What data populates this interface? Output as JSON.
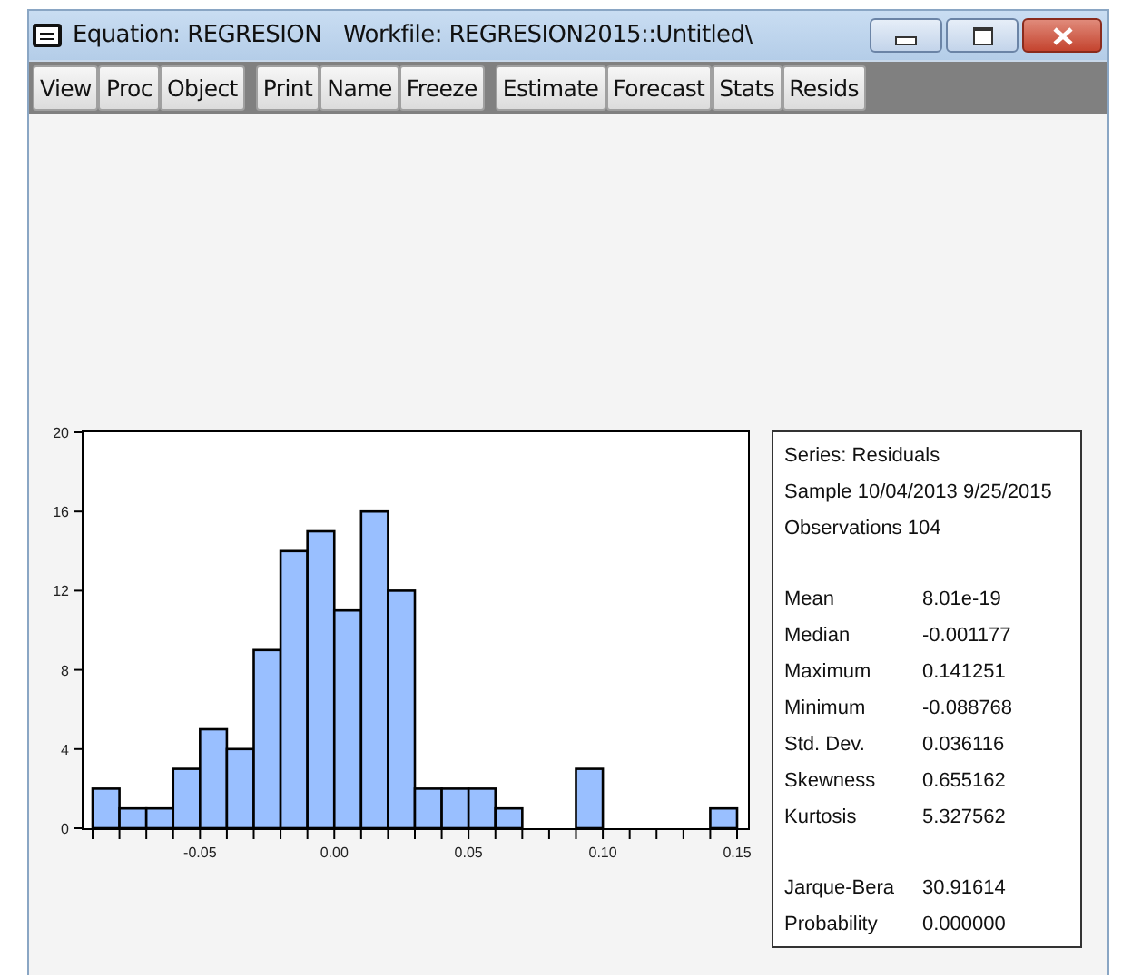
{
  "window": {
    "title": "Equation: REGRESION",
    "workfile": "Workfile: REGRESION2015::Untitled\\"
  },
  "toolbar": [
    [
      "View",
      "Proc",
      "Object"
    ],
    [
      "Print",
      "Name",
      "Freeze"
    ],
    [
      "Estimate",
      "Forecast",
      "Stats",
      "Resids"
    ]
  ],
  "histogram": {
    "chart_data": {
      "type": "bar",
      "x": [
        -0.085,
        -0.075,
        -0.065,
        -0.055,
        -0.045,
        -0.035,
        -0.025,
        -0.015,
        -0.005,
        0.005,
        0.015,
        0.025,
        0.035,
        0.045,
        0.055,
        0.065,
        0.075,
        0.085,
        0.095,
        0.105,
        0.115,
        0.125,
        0.135,
        0.145
      ],
      "values": [
        2,
        1,
        1,
        3,
        5,
        4,
        9,
        14,
        15,
        11,
        16,
        12,
        2,
        2,
        2,
        1,
        0,
        0,
        3,
        0,
        0,
        0,
        0,
        1
      ],
      "xlim": [
        -0.09,
        0.15
      ],
      "ylim": [
        0,
        20
      ],
      "xticks": [
        {
          "value": -0.05,
          "label": "-0.05"
        },
        {
          "value": 0,
          "label": "0.00"
        },
        {
          "value": 0.05,
          "label": "0.05"
        },
        {
          "value": 0.1,
          "label": "0.10"
        },
        {
          "value": 0.15,
          "label": "0.15"
        }
      ],
      "yticks": [
        0,
        4,
        8,
        12,
        16,
        20
      ]
    }
  },
  "stats": {
    "header": [
      "Series: Residuals",
      "Sample 10/04/2013 9/25/2015",
      "Observations 104"
    ],
    "groups": [
      [
        {
          "label": "Mean",
          "value": "8.01e-19"
        },
        {
          "label": "Median",
          "value": "-0.001177"
        },
        {
          "label": "Maximum",
          "value": "0.141251"
        },
        {
          "label": "Minimum",
          "value": "-0.088768"
        },
        {
          "label": "Std. Dev.",
          "value": "0.036116"
        },
        {
          "label": "Skewness",
          "value": "0.655162"
        },
        {
          "label": "Kurtosis",
          "value": "5.327562"
        }
      ],
      [
        {
          "label": "Jarque-Bera",
          "value": "30.91614"
        },
        {
          "label": "Probability",
          "value": "0.000000"
        }
      ]
    ]
  }
}
